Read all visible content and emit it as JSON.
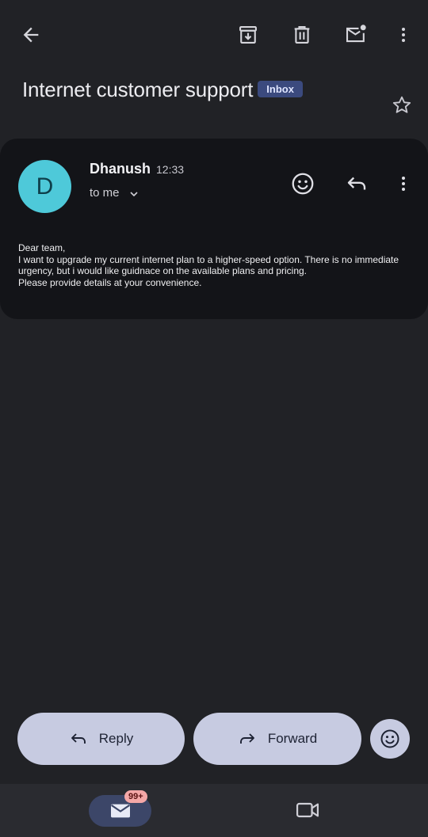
{
  "toolbar": {
    "back_icon": "arrow-back-icon",
    "archive_icon": "archive-icon",
    "delete_icon": "trash-icon",
    "mark_unread_icon": "mark-unread-icon",
    "more_icon": "more-vert-icon"
  },
  "email": {
    "subject": "Internet customer support",
    "label": "Inbox",
    "sender_initial": "D",
    "sender_name": "Dhanush",
    "time": "12:33",
    "recipient": "to me",
    "body": [
      "Dear team,",
      "I want to upgrade my current internet plan to a higher-speed option. There is no immediate urgency, but i would like guidnace on the available plans and pricing.",
      "Please provide details at your convenience."
    ]
  },
  "actions": {
    "reply_label": "Reply",
    "forward_label": "Forward"
  },
  "nav": {
    "mail_badge": "99+"
  },
  "colors": {
    "background": "#212226",
    "card": "#131418",
    "avatar": "#4ec9d9",
    "pill": "#c7cbe1",
    "label_badge": "#3b4a7e",
    "count_badge": "#f4a7a7"
  }
}
